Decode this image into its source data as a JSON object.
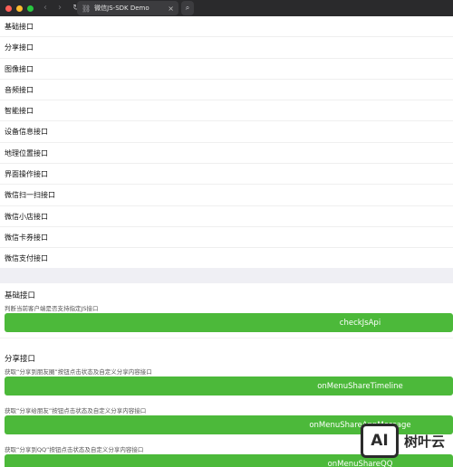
{
  "browser": {
    "tab_title": "微信JS-SDK Demo",
    "tab_close": "×",
    "back": "‹",
    "forward": "›",
    "reload": "↻",
    "search": "⌕"
  },
  "menu": {
    "items": [
      "基础接口",
      "分享接口",
      "图像接口",
      "音频接口",
      "智能接口",
      "设备信息接口",
      "地理位置接口",
      "界面操作接口",
      "微信扫一扫接口",
      "微信小店接口",
      "微信卡券接口",
      "微信支付接口"
    ]
  },
  "sections": {
    "basic": {
      "title": "基础接口",
      "desc": "判断当前客户端是否支持指定JS接口",
      "button": "checkJsApi"
    },
    "share": {
      "title": "分享接口",
      "timeline_desc": "获取“分享到朋友圈”按钮点击状态及自定义分享内容接口",
      "timeline_button": "onMenuShareTimeline",
      "appmsg_desc": "获取“分享给朋友”按钮点击状态及自定义分享内容接口",
      "appmsg_button": "onMenuShareAppMessage",
      "qq_desc": "获取“分享到QQ”按钮点击状态及自定义分享内容接口",
      "qq_button": "onMenuShareQQ"
    }
  },
  "watermark": {
    "logo": "AI",
    "text": "树叶云"
  },
  "colors": {
    "button_green": "#4cb93a",
    "titlebar": "#2a2a2c",
    "divider": "#efeff4"
  }
}
